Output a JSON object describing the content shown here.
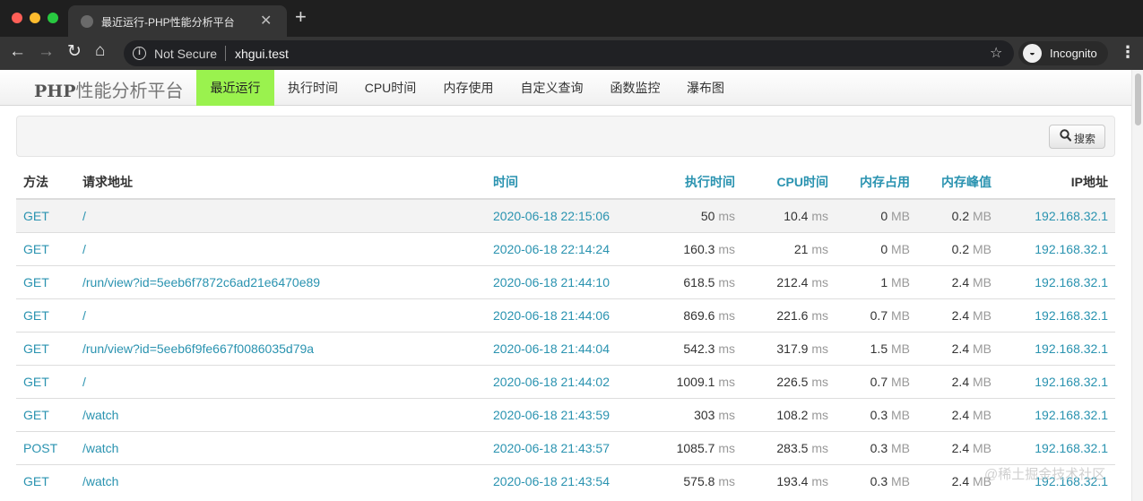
{
  "browser": {
    "tab_title": "最近运行-PHP性能分析平台",
    "not_secure": "Not Secure",
    "url": "xhgui.test",
    "incognito_label": "Incognito"
  },
  "nav": {
    "brand_bold": "PHP",
    "brand_rest": "性能分析平台",
    "items": [
      "最近运行",
      "执行时间",
      "CPU时间",
      "内存使用",
      "自定义查询",
      "函数监控",
      "瀑布图"
    ],
    "active_index": 0,
    "active_color": "#9af24e"
  },
  "search": {
    "button_label": "搜索"
  },
  "table": {
    "headers": [
      "方法",
      "请求地址",
      "时间",
      "执行时间",
      "CPU时间",
      "内存占用",
      "内存峰值",
      "IP地址"
    ],
    "units": {
      "time": "ms",
      "memory": "MB"
    },
    "rows": [
      {
        "method": "GET",
        "url": "/",
        "time": "2020-06-18 22:15:06",
        "wt": "50",
        "cpu": "10.4",
        "mu": "0",
        "pmu": "0.2",
        "ip": "192.168.32.1"
      },
      {
        "method": "GET",
        "url": "/",
        "time": "2020-06-18 22:14:24",
        "wt": "160.3",
        "cpu": "21",
        "mu": "0",
        "pmu": "0.2",
        "ip": "192.168.32.1"
      },
      {
        "method": "GET",
        "url": "/run/view?id=5eeb6f7872c6ad21e6470e89",
        "time": "2020-06-18 21:44:10",
        "wt": "618.5",
        "cpu": "212.4",
        "mu": "1",
        "pmu": "2.4",
        "ip": "192.168.32.1"
      },
      {
        "method": "GET",
        "url": "/",
        "time": "2020-06-18 21:44:06",
        "wt": "869.6",
        "cpu": "221.6",
        "mu": "0.7",
        "pmu": "2.4",
        "ip": "192.168.32.1"
      },
      {
        "method": "GET",
        "url": "/run/view?id=5eeb6f9fe667f0086035d79a",
        "time": "2020-06-18 21:44:04",
        "wt": "542.3",
        "cpu": "317.9",
        "mu": "1.5",
        "pmu": "2.4",
        "ip": "192.168.32.1"
      },
      {
        "method": "GET",
        "url": "/",
        "time": "2020-06-18 21:44:02",
        "wt": "1009.1",
        "cpu": "226.5",
        "mu": "0.7",
        "pmu": "2.4",
        "ip": "192.168.32.1"
      },
      {
        "method": "GET",
        "url": "/watch",
        "time": "2020-06-18 21:43:59",
        "wt": "303",
        "cpu": "108.2",
        "mu": "0.3",
        "pmu": "2.4",
        "ip": "192.168.32.1"
      },
      {
        "method": "POST",
        "url": "/watch",
        "time": "2020-06-18 21:43:57",
        "wt": "1085.7",
        "cpu": "283.5",
        "mu": "0.3",
        "pmu": "2.4",
        "ip": "192.168.32.1"
      },
      {
        "method": "GET",
        "url": "/watch",
        "time": "2020-06-18 21:43:54",
        "wt": "575.8",
        "cpu": "193.4",
        "mu": "0.3",
        "pmu": "2.4",
        "ip": "192.168.32.1"
      }
    ]
  },
  "watermark": "@稀土掘金技术社区",
  "colors": {
    "link": "#2a93b0",
    "tabbar": "#1f1f1f",
    "toolbar": "#353535"
  }
}
